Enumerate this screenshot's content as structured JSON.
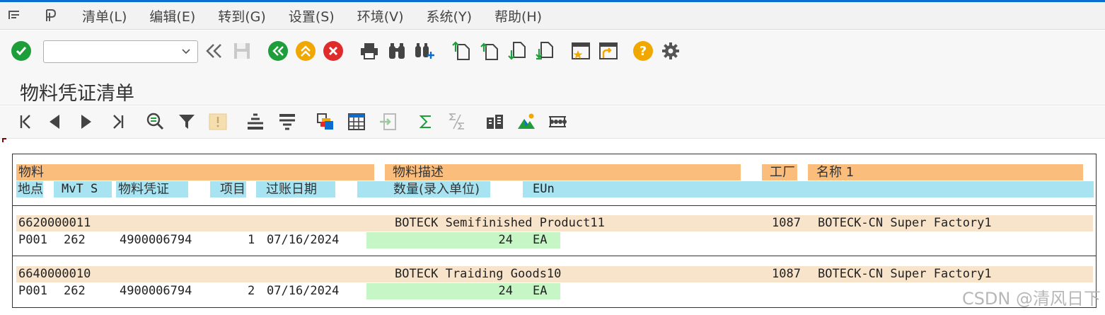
{
  "menu": {
    "items": [
      "清单(L)",
      "编辑(E)",
      "转到(G)",
      "设置(S)",
      "环境(V)",
      "系统(Y)",
      "帮助(H)"
    ]
  },
  "toolbar": {
    "command_field_value": ""
  },
  "page": {
    "title": "物料凭证清单"
  },
  "list": {
    "header1": {
      "material": "物料",
      "material_desc": "物料描述",
      "plant": "工厂",
      "name": "名称 1"
    },
    "header2": {
      "location": "地点",
      "mvt_s": "MvT S",
      "doc": "物料凭证",
      "item": "项目",
      "posting_date": "过账日期",
      "quantity": "数量(录入单位)",
      "eun": "EUn"
    },
    "records": [
      {
        "material": "6620000011",
        "desc": "BOTECK Semifinished Product11",
        "plant": "1087",
        "name": "BOTECK-CN Super Factory1",
        "location": "P001",
        "mvt": "262",
        "doc": "4900006794",
        "item": "1",
        "date": "07/16/2024",
        "qty": "24",
        "unit": "EA"
      },
      {
        "material": "6640000010",
        "desc": "BOTECK Traiding Goods10",
        "plant": "1087",
        "name": "BOTECK-CN Super Factory1",
        "location": "P001",
        "mvt": "262",
        "doc": "4900006794",
        "item": "2",
        "date": "07/16/2024",
        "qty": "24",
        "unit": "EA"
      }
    ]
  },
  "watermark": "CSDN @清风日下",
  "colors": {
    "header_orange": "#fbbd7c",
    "header_blue": "#a8e3f2",
    "row_orange": "#f8e4cb",
    "row_green": "#c6f5c6",
    "accent_green": "#1e9e3a",
    "accent_orange": "#f0a800",
    "accent_red": "#e02b2b"
  }
}
